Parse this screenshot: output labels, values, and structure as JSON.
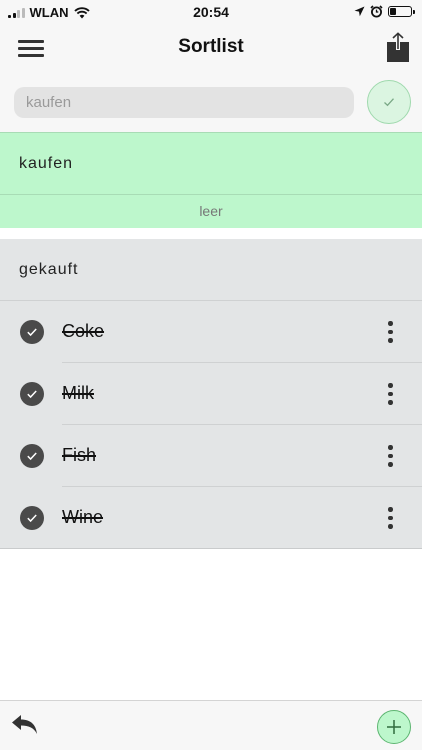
{
  "status_bar": {
    "carrier": "WLAN",
    "time": "20:54",
    "battery_level": 0.3,
    "icons": [
      "signal-icon",
      "wifi-icon",
      "location-icon",
      "alarm-icon",
      "battery-icon"
    ]
  },
  "nav": {
    "title": "Sortlist",
    "menu_icon": "hamburger-menu-icon",
    "share_icon": "share-icon"
  },
  "input": {
    "placeholder": "kaufen",
    "value": "",
    "confirm_icon": "checkmark-icon"
  },
  "to_buy": {
    "title": "kaufen",
    "empty_text": "leer",
    "items": []
  },
  "bought": {
    "title": "gekauft",
    "items": [
      {
        "label": "Coke",
        "checked": true
      },
      {
        "label": "Milk",
        "checked": true
      },
      {
        "label": "Fish",
        "checked": true
      },
      {
        "label": "Wine",
        "checked": true
      }
    ]
  },
  "toolbar": {
    "undo_icon": "undo-icon",
    "add_icon": "plus-icon"
  },
  "colors": {
    "to_buy_bg": "#bdf7cc",
    "bought_bg": "#e3e5e6",
    "accent_green": "#5cb570",
    "check_fill": "#4a4a4a"
  }
}
